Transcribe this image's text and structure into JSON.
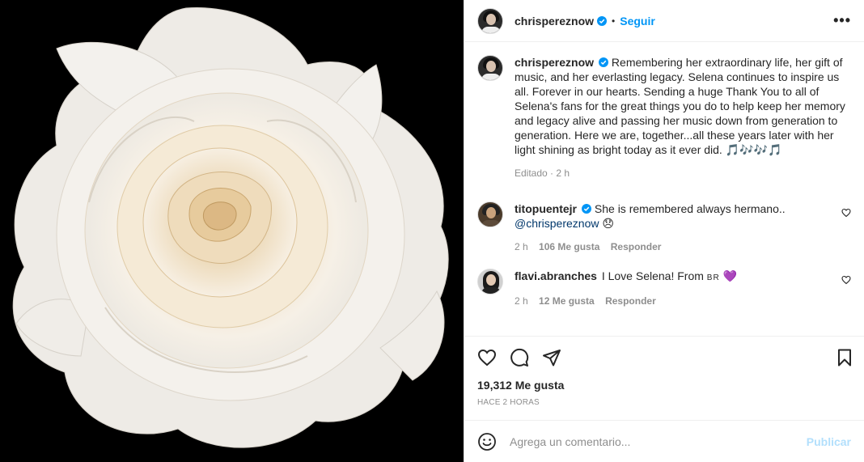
{
  "header": {
    "username": "chrispereznow",
    "separator": "•",
    "follow_label": "Seguir",
    "more_label": "•••"
  },
  "caption": {
    "username": "chrispereznow",
    "text": "Remembering her extraordinary life, her gift of music, and her everlasting legacy. Selena continues to inspire us all. Forever in our hearts. Sending a huge Thank You to all of Selena's fans for the great things you do to help keep her memory and legacy alive and passing her music down from generation to generation. Here we are, together...all these years later with her light shining as bright today as it ever did.",
    "emoji": "🎵🎶🎶🎵",
    "meta": "Editado · 2 h"
  },
  "comments": [
    {
      "username": "titopuentejr",
      "text": "She is remembered always hermano..",
      "mention": "@chrispereznow",
      "emoji": "😞",
      "time": "2 h",
      "likes": "106 Me gusta",
      "reply": "Responder"
    },
    {
      "username": "flavi.abranches",
      "text": "I Love Selena! From",
      "flag": "BR",
      "emoji": "💜",
      "time": "2 h",
      "likes": "12 Me gusta",
      "reply": "Responder"
    }
  ],
  "post": {
    "likes": "19,312 Me gusta",
    "time": "HACE 2 HORAS"
  },
  "add_comment": {
    "placeholder": "Agrega un comentario...",
    "publish_label": "Publicar"
  },
  "colors": {
    "accent": "#0095f6",
    "publish_disabled": "#b2dffc",
    "muted": "#8e8e8e",
    "image_bg": "#000000"
  }
}
